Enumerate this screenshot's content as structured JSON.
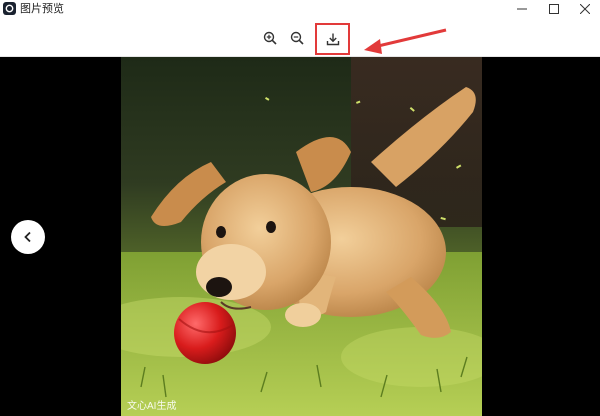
{
  "window": {
    "title": "图片预览",
    "app_icon": "image-viewer-app-icon",
    "controls": [
      "minimize-icon",
      "maximize-icon",
      "close-icon"
    ]
  },
  "toolbar": {
    "buttons": [
      "zoom-in-icon",
      "zoom-out-icon",
      "download-icon"
    ],
    "highlight_color": "#e23a3a"
  },
  "viewer": {
    "watermark": "文心AI生成",
    "prev_button": "chevron-left-icon",
    "background": "#000000"
  }
}
